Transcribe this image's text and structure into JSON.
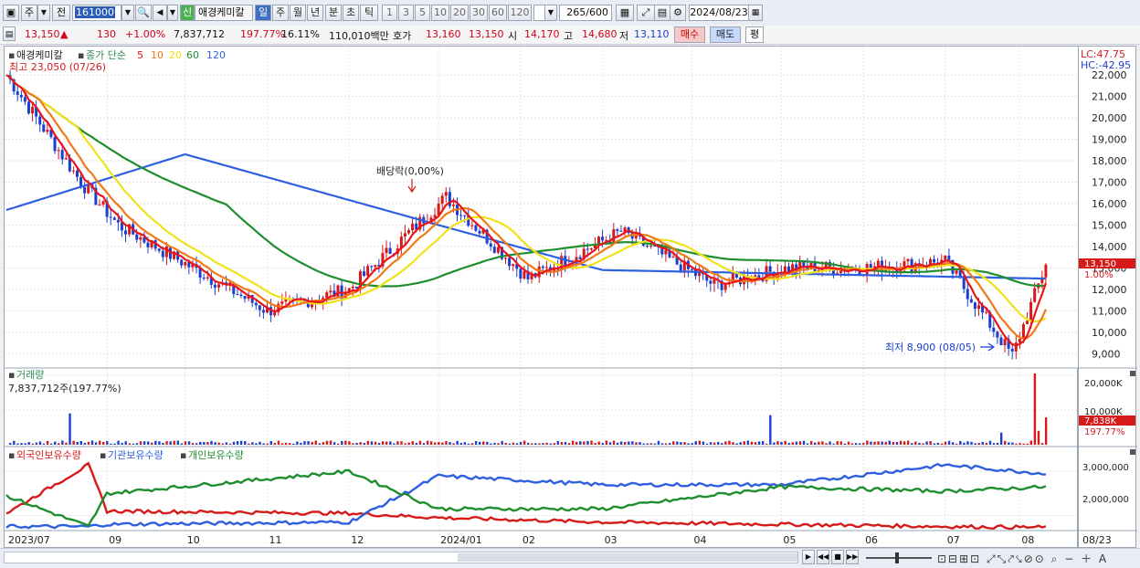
{
  "toolbar": {
    "market_label": "주",
    "prev_label": "전",
    "stock_code": "161000",
    "new_badge": "신",
    "stock_name": "애경케미칼",
    "period_buttons": [
      "일",
      "주",
      "월",
      "년",
      "분",
      "초",
      "틱"
    ],
    "active_period": "일",
    "interval_buttons": [
      "1",
      "3",
      "5",
      "10",
      "20",
      "30",
      "60",
      "120"
    ],
    "count_value": "265",
    "count_total": "/600",
    "date_value": "2024/08/23"
  },
  "info": {
    "price": "13,150",
    "change_arrow": "▲",
    "change": "130",
    "change_rate": "+1.00%",
    "volume": "7,837,712",
    "volume_ratio": "197.77%",
    "turnover": "16.11%",
    "amount": "110,010백만",
    "quote_label": "호가",
    "ask": "13,160",
    "bid": "13,150",
    "open_label": "시",
    "open": "14,170",
    "high_label": "고",
    "high": "14,680",
    "low_label": "저",
    "low": "13,110",
    "buy_button": "매수",
    "sell_button": "매도",
    "eval_button": "평"
  },
  "price_panel": {
    "stock_label": "애경케미칼",
    "ma_label": "종가 단순",
    "ma_periods": [
      {
        "label": "5",
        "color": "#e8151b"
      },
      {
        "label": "10",
        "color": "#f07a16"
      },
      {
        "label": "20",
        "color": "#f0e21a"
      },
      {
        "label": "60",
        "color": "#1e8e2e"
      },
      {
        "label": "120",
        "color": "#2e5fe0"
      }
    ],
    "high_annotation": "최고 23,050 (07/26)",
    "dividend_annotation": "배당락(0,00%)",
    "low_annotation": "최저 8,900 (08/05)",
    "lc_label": "LC:47.75",
    "hc_label": "HC:-42.95",
    "price_ticks": [
      "22,000",
      "21,000",
      "20,000",
      "19,000",
      "18,000",
      "17,000",
      "16,000",
      "15,000",
      "14,000",
      "13,000",
      "12,000",
      "11,000",
      "10,000",
      "9,000"
    ],
    "current_price_tag": "13,150",
    "current_rate_tag": "1.00%"
  },
  "volume_panel": {
    "title": "거래량",
    "value_label": "7,837,712주(197.77%)",
    "ticks": [
      "20,000K",
      "10,000K"
    ],
    "current_tag": "7,838K",
    "current_rate_tag": "197.77%"
  },
  "holding_panel": {
    "series": [
      {
        "label": "외국인보유수량",
        "color": "#d61a1a"
      },
      {
        "label": "기관보유수량",
        "color": "#2e5fe0"
      },
      {
        "label": "개인보유수량",
        "color": "#1e8e2e"
      }
    ],
    "ticks": [
      "3,000,000",
      "2,000,000"
    ]
  },
  "x_axis": {
    "labels": [
      "2023/07",
      "09",
      "10",
      "11",
      "12",
      "2024/01",
      "02",
      "03",
      "04",
      "05",
      "06",
      "07",
      "08"
    ],
    "end_label": "08/23"
  },
  "chart_data": {
    "type": "line",
    "price": {
      "x": [
        "2023/07",
        "2023/08",
        "2023/09",
        "2023/10",
        "2023/11",
        "2023/12",
        "2024/01",
        "2024/02",
        "2024/03",
        "2024/04",
        "2024/05",
        "2024/06",
        "2024/07",
        "2024/08/05",
        "2024/08/23"
      ],
      "close": [
        22000,
        17000,
        15000,
        12500,
        11000,
        12000,
        16300,
        12500,
        14700,
        12200,
        13000,
        13000,
        13300,
        8900,
        13150
      ],
      "ylim": [
        8500,
        22900
      ],
      "high": {
        "value": 23050,
        "date": "07/26"
      },
      "low": {
        "value": 8900,
        "date": "08/05"
      }
    },
    "ma120": {
      "x": [
        "2023/07",
        "2023/10",
        "2024/01",
        "2024/03",
        "2024/08/23"
      ],
      "values": [
        15700,
        18300,
        15000,
        12900,
        12500
      ]
    },
    "volume": {
      "ylim": [
        0,
        21000
      ],
      "last": 7838,
      "unit": "K"
    },
    "holdings": {
      "ylim": [
        1700000,
        3400000
      ],
      "x": [
        "2023/07",
        "2023/08",
        "2023/09",
        "2023/12",
        "2024/01",
        "2024/03",
        "2024/05",
        "2024/07",
        "2024/08/23"
      ],
      "series": [
        {
          "name": "외국인보유수량",
          "values": [
            2050000,
            3150000,
            2100000,
            2050000,
            1950000,
            1850000,
            1800000,
            1750000,
            1730000
          ]
        },
        {
          "name": "기관보유수량",
          "values": [
            1750000,
            1750000,
            1800000,
            1850000,
            2900000,
            2700000,
            2700000,
            3150000,
            2950000
          ]
        },
        {
          "name": "개인보유수량",
          "values": [
            2450000,
            1750000,
            2500000,
            3000000,
            2150000,
            2150000,
            2650000,
            2550000,
            2650000
          ]
        }
      ]
    }
  }
}
